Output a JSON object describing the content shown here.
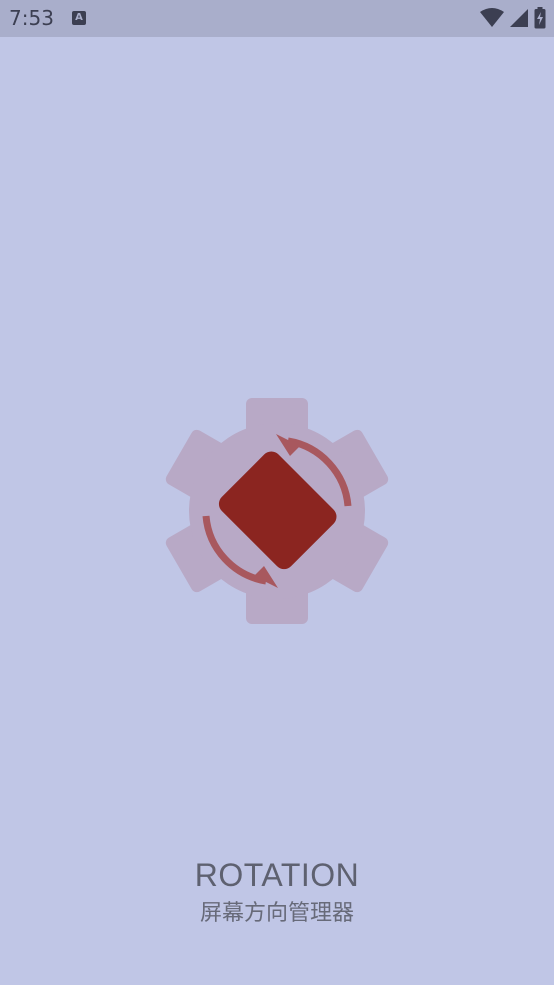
{
  "status_bar": {
    "time": "7:53",
    "notification_icon": "A",
    "icons": [
      "wifi-icon",
      "cell-signal-icon",
      "battery-charging-icon"
    ]
  },
  "splash": {
    "logo_icon": "rotation-gear-icon",
    "title": "ROTATION",
    "subtitle": "屏幕方向管理器"
  },
  "colors": {
    "background": "#c0c6e6",
    "status_bar": "#a9aecb",
    "gear": "#b8a9c6",
    "phone": "#8b2520",
    "arrows": "#a8585e",
    "title_text": "#5e6170"
  }
}
